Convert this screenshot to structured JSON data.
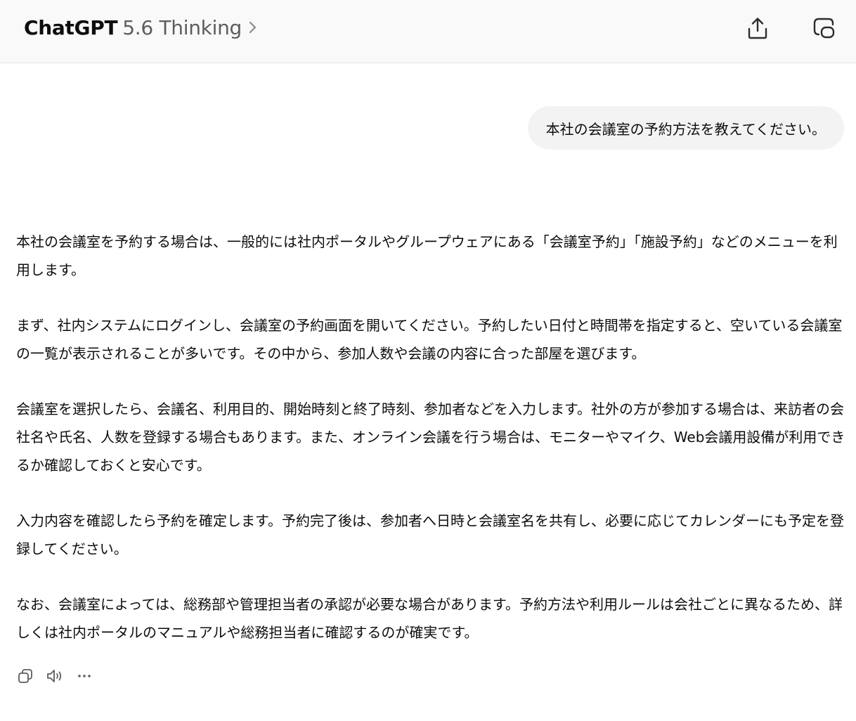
{
  "header": {
    "brand": "ChatGPT",
    "model": "5.6 Thinking",
    "icons": {
      "model_chevron": "chevron-right-icon",
      "share": "share-icon",
      "new_chat": "new-chat-icon"
    }
  },
  "conversation": {
    "user_message": "本社の会議室の予約方法を教えてください。",
    "assistant_paragraphs": [
      "本社の会議室を予約する場合は、一般的には社内ポータルやグループウェアにある「会議室予約」「施設予約」などのメニューを利用します。",
      "まず、社内システムにログインし、会議室の予約画面を開いてください。予約したい日付と時間帯を指定すると、空いている会議室の一覧が表示されることが多いです。その中から、参加人数や会議の内容に合った部屋を選びます。",
      "会議室を選択したら、会議名、利用目的、開始時刻と終了時刻、参加者などを入力します。社外の方が参加する場合は、来訪者の会社名や氏名、人数を登録する場合もあります。また、オンライン会議を行う場合は、モニターやマイク、Web会議用設備が利用できるか確認しておくと安心です。",
      "入力内容を確認したら予約を確定します。予約完了後は、参加者へ日時と会議室名を共有し、必要に応じてカレンダーにも予定を登録してください。",
      "なお、会議室によっては、総務部や管理担当者の承認が必要な場合があります。予約方法や利用ルールは会社ごとに異なるため、詳しくは社内ポータルのマニュアルや総務担当者に確認するのが確実です。"
    ]
  },
  "message_actions": {
    "icons": [
      "copy-icon",
      "read-aloud-icon",
      "more-icon"
    ]
  }
}
